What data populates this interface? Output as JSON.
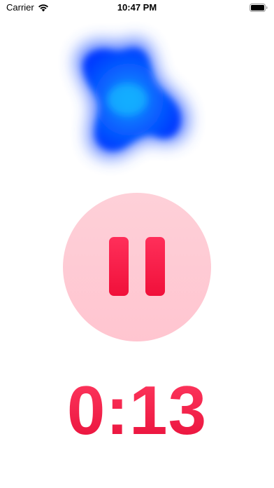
{
  "status_bar": {
    "carrier": "Carrier",
    "time": "10:47 PM",
    "wifi_icon": "wifi-icon",
    "battery_icon": "battery-icon"
  },
  "visualizer": {
    "icon": "audio-blob-icon",
    "colors": {
      "core": "#0aa6ff",
      "body": "#0040ff",
      "glow": "#4a7dff"
    }
  },
  "pause_button": {
    "icon": "pause-icon",
    "background": "#ffc8d2",
    "accent": "#f5143f"
  },
  "timer": {
    "elapsed": "0:13",
    "color": "#f5143f"
  }
}
